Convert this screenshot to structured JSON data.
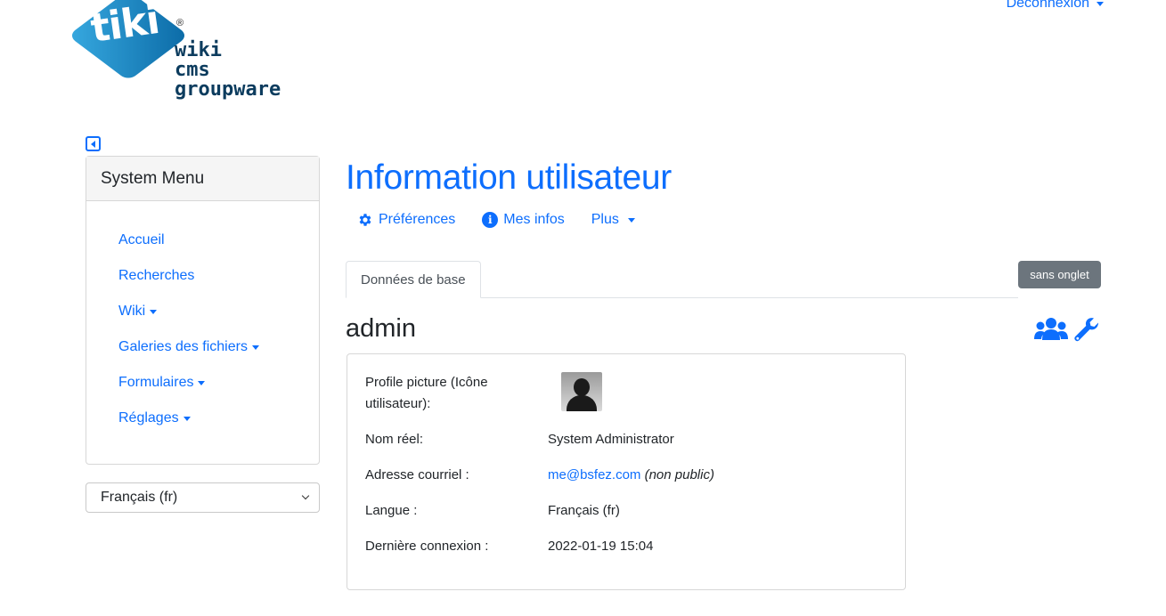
{
  "header": {
    "logout_label": "Déconnexion",
    "logo": {
      "tiki": "tiki",
      "reg": "®",
      "line1": "wiki",
      "line2": "cms",
      "line3": "groupware"
    }
  },
  "sidebar": {
    "toggle_icon": "sidebar-collapse-icon",
    "menu_title": "System Menu",
    "items": [
      {
        "label": "Accueil",
        "dropdown": false
      },
      {
        "label": "Recherches",
        "dropdown": false
      },
      {
        "label": "Wiki",
        "dropdown": true
      },
      {
        "label": "Galeries des fichiers",
        "dropdown": true
      },
      {
        "label": "Formulaires",
        "dropdown": true
      },
      {
        "label": "Réglages",
        "dropdown": true
      }
    ],
    "language_select": "Français (fr)"
  },
  "main": {
    "title": "Information utilisateur",
    "nav": {
      "preferences": "Préférences",
      "mes_infos": "Mes infos",
      "plus": "Plus"
    },
    "tab_label": "Données de base",
    "sans_onglet": "sans onglet",
    "username": "admin",
    "details": {
      "profile_picture_label_1": "Profile picture (Icône",
      "profile_picture_label_2": "utilisateur):",
      "real_name_label": "Nom réel:",
      "real_name_value": "System Administrator",
      "email_label": "Adresse courriel :",
      "email_value": "me@bsfez.com",
      "email_note": "(non public)",
      "language_label": "Langue :",
      "language_value": "Français (fr)",
      "last_login_label": "Dernière connexion :",
      "last_login_value": "2022-01-19 15:04"
    }
  },
  "colors": {
    "link": "#0d6efd",
    "badge_bg": "#6c757d"
  }
}
